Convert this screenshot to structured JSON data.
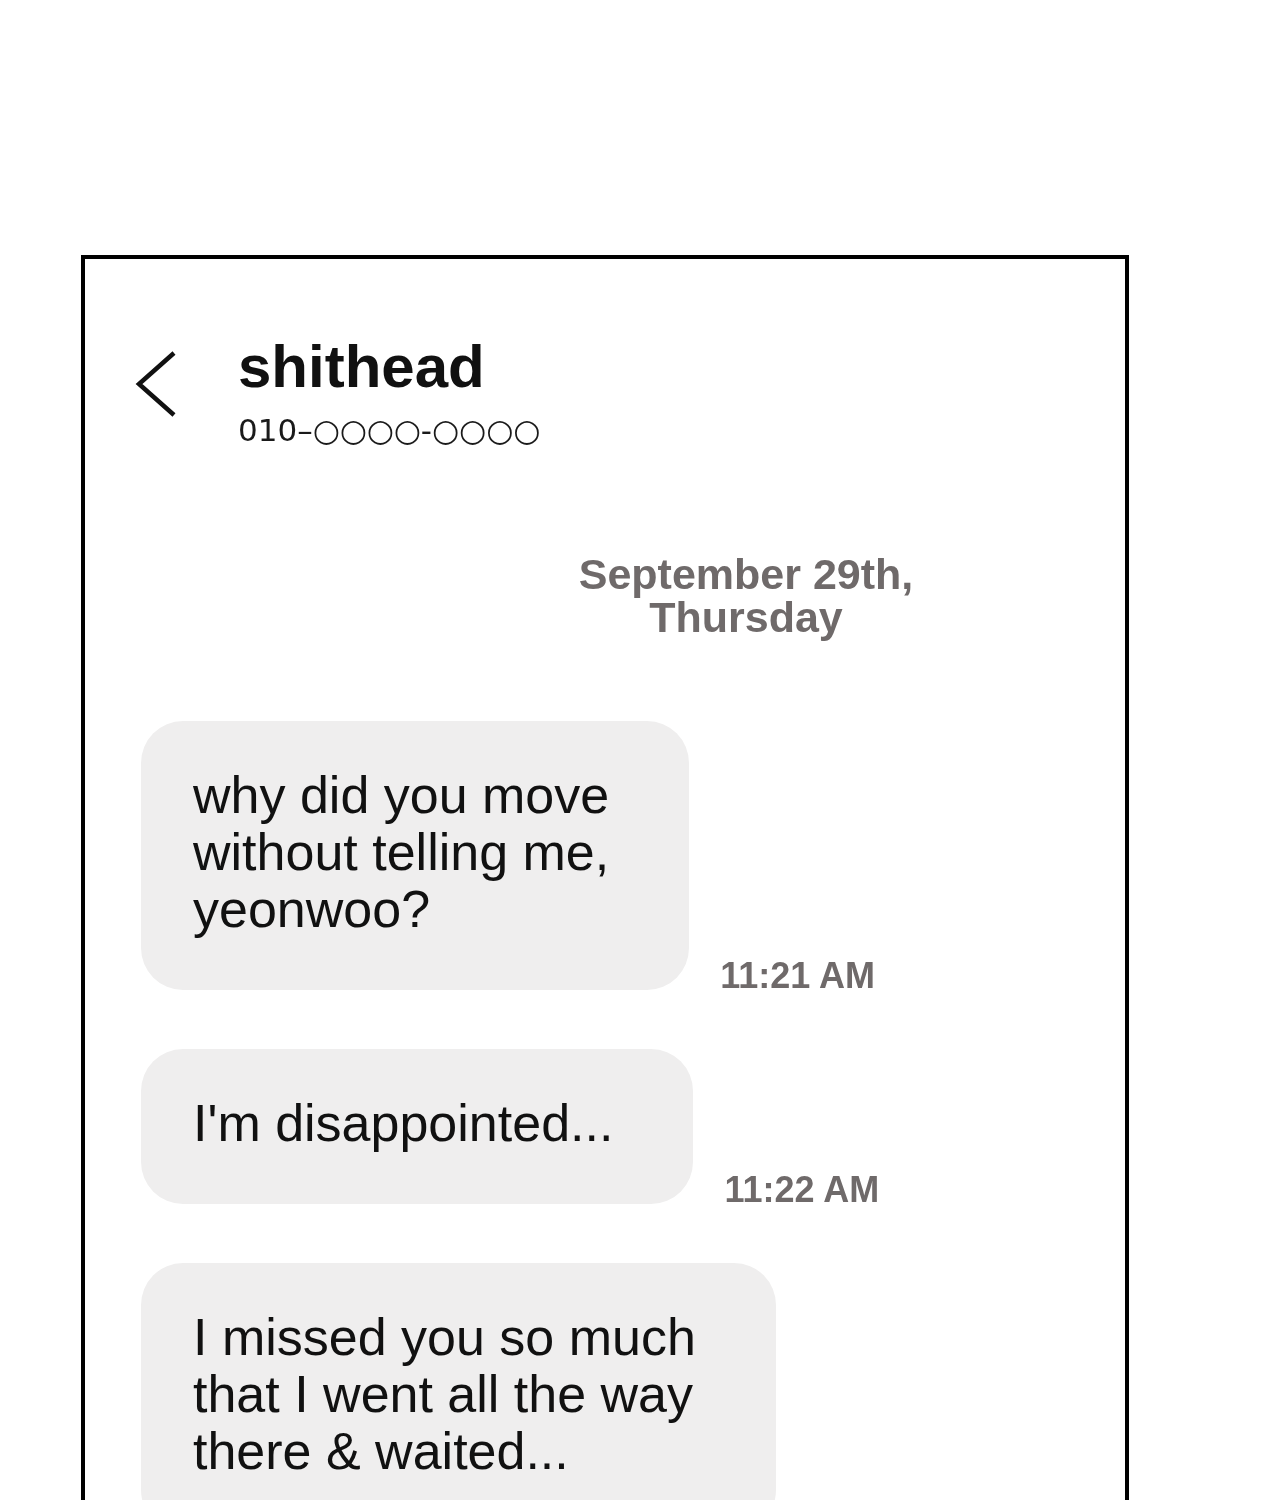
{
  "contact": {
    "name": "shithead",
    "phone": "010–○○○○-○○○○"
  },
  "date_divider": "September 29th, Thursday",
  "messages": [
    {
      "text": "why did you move\nwithout telling me,\nyeonwoo?",
      "time": "11:21 AM"
    },
    {
      "text": "I'm disappointed...",
      "time": "11:22 AM"
    },
    {
      "text": "I missed you so much\nthat I went all the way\nthere & waited..."
    }
  ]
}
